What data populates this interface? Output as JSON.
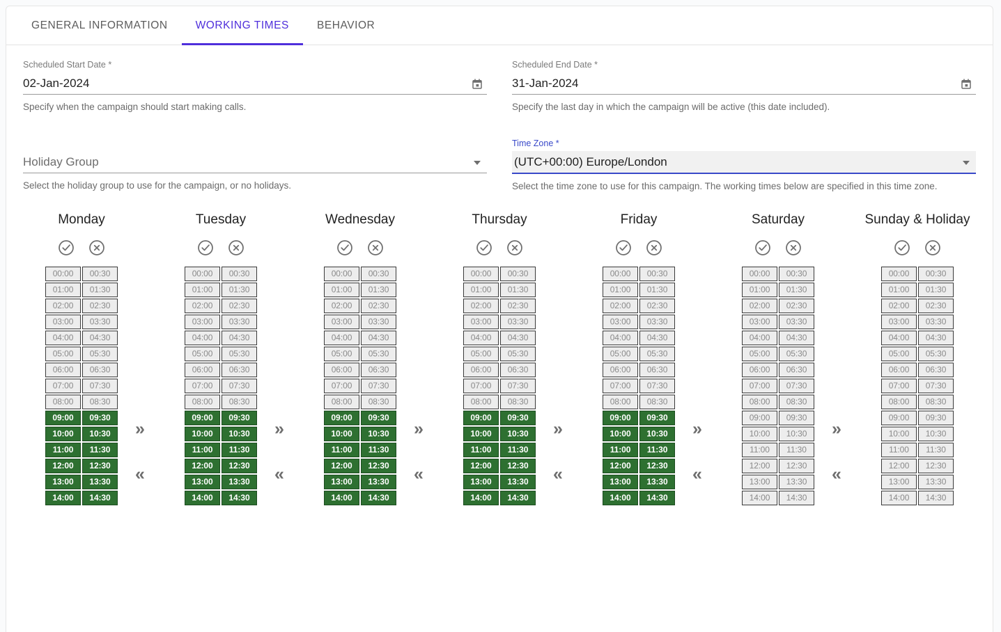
{
  "tabs": [
    {
      "label": "GENERAL INFORMATION",
      "active": false
    },
    {
      "label": "WORKING TIMES",
      "active": true
    },
    {
      "label": "BEHAVIOR",
      "active": false
    }
  ],
  "fields": {
    "start_date": {
      "label": "Scheduled Start Date",
      "required": "*",
      "value": "02-Jan-2024",
      "hint": "Specify when the campaign should start making calls.",
      "icon": "calendar-icon"
    },
    "end_date": {
      "label": "Scheduled End Date",
      "required": "*",
      "value": "31-Jan-2024",
      "hint": "Specify the last day in which the campaign will be active (this date included).",
      "icon": "calendar-icon"
    },
    "holiday_group": {
      "label": "Holiday Group",
      "required": "",
      "value": "Holiday Group",
      "hint": "Select the holiday group to use for the campaign, or no holidays.",
      "icon": "chevron-down-icon"
    },
    "time_zone": {
      "label": "Time Zone",
      "required": "*",
      "value": "(UTC+00:00) Europe/London",
      "hint": "Select the time zone to use for this campaign. The working times below are specified in this time zone.",
      "icon": "chevron-down-icon"
    }
  },
  "schedule": {
    "select_all_icon": "check-circle-icon",
    "clear_all_icon": "x-circle-icon",
    "forward_icon": "double-chevron-right-icon",
    "back_icon": "double-chevron-left-icon",
    "forward_glyph": "»",
    "back_glyph": "«",
    "slots": [
      "00:00",
      "00:30",
      "01:00",
      "01:30",
      "02:00",
      "02:30",
      "03:00",
      "03:30",
      "04:00",
      "04:30",
      "05:00",
      "05:30",
      "06:00",
      "06:30",
      "07:00",
      "07:30",
      "08:00",
      "08:30",
      "09:00",
      "09:30",
      "10:00",
      "10:30",
      "11:00",
      "11:30",
      "12:00",
      "12:30",
      "13:00",
      "13:30",
      "14:00",
      "14:30"
    ],
    "days": [
      {
        "name": "Monday",
        "selected": [
          "09:00",
          "09:30",
          "10:00",
          "10:30",
          "11:00",
          "11:30",
          "12:00",
          "12:30",
          "13:00",
          "13:30",
          "14:00",
          "14:30"
        ]
      },
      {
        "name": "Tuesday",
        "selected": [
          "09:00",
          "09:30",
          "10:00",
          "10:30",
          "11:00",
          "11:30",
          "12:00",
          "12:30",
          "13:00",
          "13:30",
          "14:00",
          "14:30"
        ]
      },
      {
        "name": "Wednesday",
        "selected": [
          "09:00",
          "09:30",
          "10:00",
          "10:30",
          "11:00",
          "11:30",
          "12:00",
          "12:30",
          "13:00",
          "13:30",
          "14:00",
          "14:30"
        ]
      },
      {
        "name": "Thursday",
        "selected": [
          "09:00",
          "09:30",
          "10:00",
          "10:30",
          "11:00",
          "11:30",
          "12:00",
          "12:30",
          "13:00",
          "13:30",
          "14:00",
          "14:30"
        ]
      },
      {
        "name": "Friday",
        "selected": [
          "09:00",
          "09:30",
          "10:00",
          "10:30",
          "11:00",
          "11:30",
          "12:00",
          "12:30",
          "13:00",
          "13:30",
          "14:00",
          "14:30"
        ]
      },
      {
        "name": "Saturday",
        "selected": []
      },
      {
        "name": "Sunday & Holiday",
        "selected": []
      }
    ]
  },
  "colors": {
    "accent_purple": "#4f2fdb",
    "focus_blue": "#3949c9",
    "slot_on_green": "#2e7031",
    "slot_off_grey": "#ededed"
  }
}
